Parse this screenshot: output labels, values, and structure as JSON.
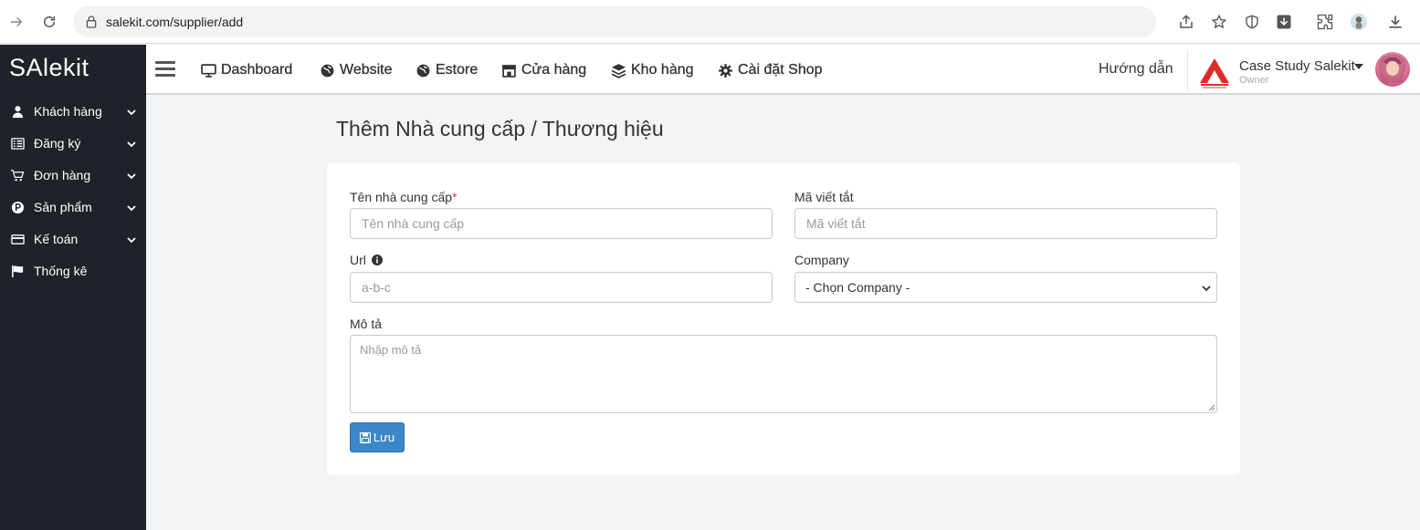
{
  "browser": {
    "url": "salekit.com/supplier/add"
  },
  "sidebar": {
    "logo": "SAlekit",
    "items": [
      {
        "label": "Khách hàng",
        "icon": "user-icon",
        "has_submenu": true
      },
      {
        "label": "Đăng ký",
        "icon": "list-icon",
        "has_submenu": true
      },
      {
        "label": "Đơn hàng",
        "icon": "cart-icon",
        "has_submenu": true
      },
      {
        "label": "Sản phẩm",
        "icon": "product-p-icon",
        "has_submenu": true
      },
      {
        "label": "Kế toán",
        "icon": "credit-card-icon",
        "has_submenu": true
      },
      {
        "label": "Thống kê",
        "icon": "flag-icon",
        "has_submenu": false
      }
    ]
  },
  "topnav": {
    "links": [
      {
        "label": "Dashboard",
        "icon": "monitor-icon"
      },
      {
        "label": "Website",
        "icon": "globe-icon"
      },
      {
        "label": "Estore",
        "icon": "globe-icon"
      },
      {
        "label": "Cửa hàng",
        "icon": "store-icon"
      },
      {
        "label": "Kho hàng",
        "icon": "layers-icon"
      },
      {
        "label": "Cài đặt Shop",
        "icon": "gear-icon"
      }
    ],
    "guide": "Hướng dẫn",
    "company_name": "Case Study Salekit",
    "company_role": "Owner"
  },
  "page": {
    "title": "Thêm Nhà cung cấp / Thương hiệu"
  },
  "form": {
    "supplier_name_label": "Tên nhà cung cấp",
    "required_mark": "*",
    "supplier_name_placeholder": "Tên nhà cung cấp",
    "abbr_label": "Mã viết tắt",
    "abbr_placeholder": "Mã viết tắt",
    "url_label": "Url",
    "url_placeholder": "a-b-c",
    "company_label": "Company",
    "company_selected": "- Chọn Company -",
    "description_label": "Mô tả",
    "description_placeholder": "Nhập mô tả",
    "save_label": "Lưu"
  },
  "colors": {
    "sidebar_bg": "#1f2329",
    "save_button": "#3c87c9",
    "required": "#e23d3d",
    "page_bg": "#f3f4f6"
  }
}
